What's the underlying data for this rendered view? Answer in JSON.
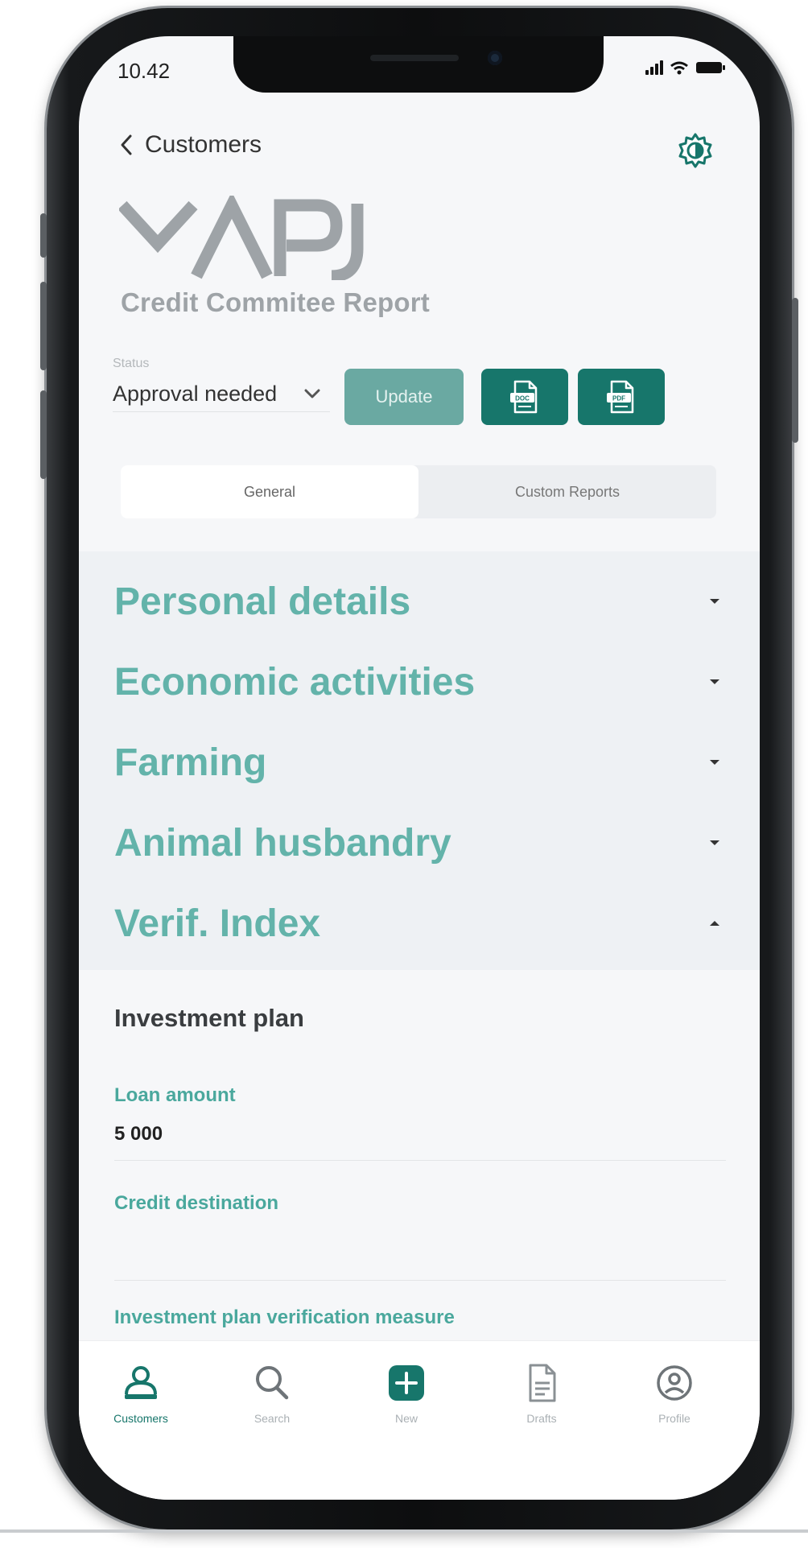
{
  "status_bar": {
    "time": "10.42"
  },
  "header": {
    "back_label": "Customers",
    "title": "Credit Commitee Report"
  },
  "status": {
    "label": "Status",
    "value": "Approval needed"
  },
  "actions": {
    "update_label": "Update"
  },
  "tabs": [
    {
      "label": "General",
      "active": true
    },
    {
      "label": "Custom Reports",
      "active": false
    }
  ],
  "accordion": [
    {
      "label": "Personal details",
      "expanded": false
    },
    {
      "label": "Economic activities",
      "expanded": false
    },
    {
      "label": "Farming",
      "expanded": false
    },
    {
      "label": "Animal husbandry",
      "expanded": false
    },
    {
      "label": "Verif. Index",
      "expanded": true
    }
  ],
  "investment_plan": {
    "title": "Investment plan",
    "loan_amount_label": "Loan amount",
    "loan_amount_value": "5 000",
    "credit_destination_label": "Credit destination",
    "verification_label": "Investment plan verification measure"
  },
  "bottom_nav": [
    {
      "label": "Customers",
      "icon": "customers-icon",
      "active": true
    },
    {
      "label": "Search",
      "icon": "search-icon",
      "active": false
    },
    {
      "label": "New",
      "icon": "plus-icon",
      "active": false
    },
    {
      "label": "Drafts",
      "icon": "document-icon",
      "active": false
    },
    {
      "label": "Profile",
      "icon": "profile-icon",
      "active": false
    }
  ],
  "colors": {
    "accent": "#17766b",
    "accent_light": "#63b3aa",
    "update_button": "#6aa9a2",
    "accordion_bg": "#eef1f4"
  }
}
